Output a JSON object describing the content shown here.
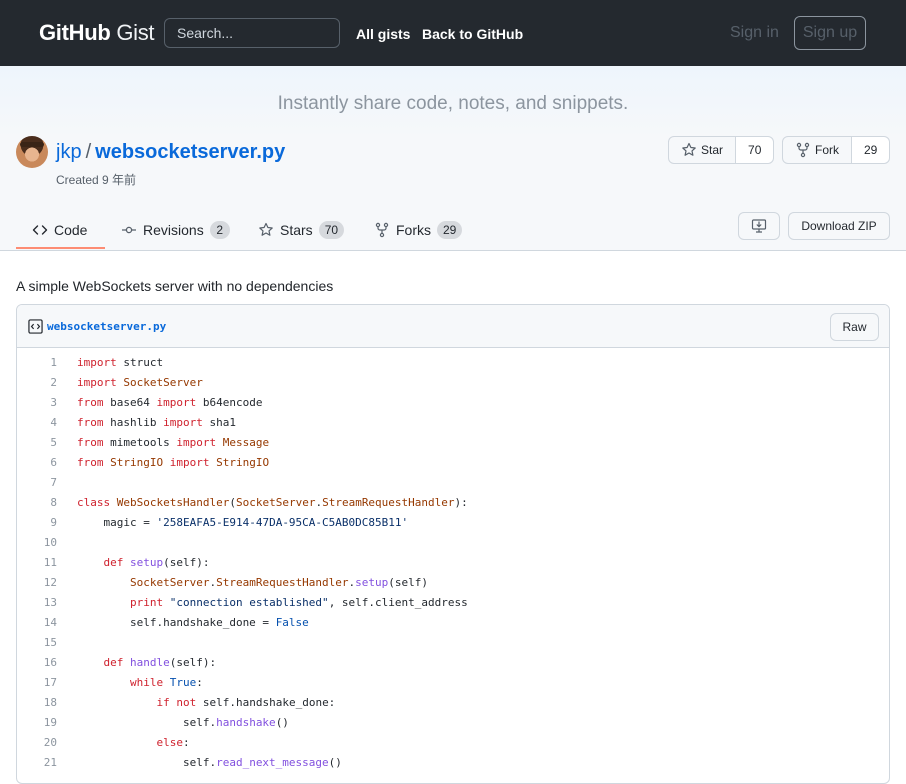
{
  "header": {
    "logo_bold": "GitHub",
    "logo_light": "Gist",
    "search_placeholder": "Search...",
    "all_gists": "All gists",
    "back_to_github": "Back to GitHub",
    "sign_in": "Sign in",
    "sign_up": "Sign up"
  },
  "banner": {
    "tagline": "Instantly share code, notes, and snippets."
  },
  "gist": {
    "owner": "jkp",
    "separator": "/",
    "filename": "websocketserver.py",
    "created": "Created 9 年前",
    "star_label": "Star",
    "star_count": "70",
    "fork_label": "Fork",
    "fork_count": "29",
    "description": "A simple WebSockets server with no dependencies"
  },
  "tabs": [
    {
      "label": "Code",
      "count": ""
    },
    {
      "label": "Revisions",
      "count": "2"
    },
    {
      "label": "Stars",
      "count": "70"
    },
    {
      "label": "Forks",
      "count": "29"
    }
  ],
  "actions": {
    "download_zip": "Download ZIP",
    "raw": "Raw"
  },
  "file": {
    "name": "websocketserver.py",
    "lines": [
      {
        "n": "1",
        "t": [
          [
            "k",
            "import"
          ],
          [
            "p",
            " struct"
          ]
        ]
      },
      {
        "n": "2",
        "t": [
          [
            "k",
            "import"
          ],
          [
            "p",
            " "
          ],
          [
            "n",
            "SocketServer"
          ]
        ]
      },
      {
        "n": "3",
        "t": [
          [
            "k",
            "from"
          ],
          [
            "p",
            " base64 "
          ],
          [
            "k",
            "import"
          ],
          [
            "p",
            " b64encode"
          ]
        ]
      },
      {
        "n": "4",
        "t": [
          [
            "k",
            "from"
          ],
          [
            "p",
            " hashlib "
          ],
          [
            "k",
            "import"
          ],
          [
            "p",
            " sha1"
          ]
        ]
      },
      {
        "n": "5",
        "t": [
          [
            "k",
            "from"
          ],
          [
            "p",
            " mimetools "
          ],
          [
            "k",
            "import"
          ],
          [
            "p",
            " "
          ],
          [
            "n",
            "Message"
          ]
        ]
      },
      {
        "n": "6",
        "t": [
          [
            "k",
            "from"
          ],
          [
            "p",
            " "
          ],
          [
            "n",
            "StringIO"
          ],
          [
            "p",
            " "
          ],
          [
            "k",
            "import"
          ],
          [
            "p",
            " "
          ],
          [
            "n",
            "StringIO"
          ]
        ]
      },
      {
        "n": "7",
        "t": []
      },
      {
        "n": "8",
        "t": [
          [
            "k",
            "class"
          ],
          [
            "p",
            " "
          ],
          [
            "n",
            "WebSocketsHandler"
          ],
          [
            "p",
            "("
          ],
          [
            "n",
            "SocketServer"
          ],
          [
            "p",
            "."
          ],
          [
            "n",
            "StreamRequestHandler"
          ],
          [
            "p",
            "):"
          ]
        ]
      },
      {
        "n": "9",
        "t": [
          [
            "p",
            "    magic = "
          ],
          [
            "s",
            "'258EAFA5-E914-47DA-95CA-C5AB0DC85B11'"
          ]
        ]
      },
      {
        "n": "10",
        "t": []
      },
      {
        "n": "11",
        "t": [
          [
            "p",
            "    "
          ],
          [
            "k",
            "def"
          ],
          [
            "p",
            " "
          ],
          [
            "f",
            "setup"
          ],
          [
            "p",
            "(self):"
          ]
        ]
      },
      {
        "n": "12",
        "t": [
          [
            "p",
            "        "
          ],
          [
            "n",
            "SocketServer"
          ],
          [
            "p",
            "."
          ],
          [
            "n",
            "StreamRequestHandler"
          ],
          [
            "p",
            "."
          ],
          [
            "f",
            "setup"
          ],
          [
            "p",
            "(self)"
          ]
        ]
      },
      {
        "n": "13",
        "t": [
          [
            "p",
            "        "
          ],
          [
            "k",
            "print"
          ],
          [
            "p",
            " "
          ],
          [
            "s",
            "\"connection established\""
          ],
          [
            "p",
            ", self.client_address"
          ]
        ]
      },
      {
        "n": "14",
        "t": [
          [
            "p",
            "        self.handshake_done = "
          ],
          [
            "c1",
            "False"
          ]
        ]
      },
      {
        "n": "15",
        "t": []
      },
      {
        "n": "16",
        "t": [
          [
            "p",
            "    "
          ],
          [
            "k",
            "def"
          ],
          [
            "p",
            " "
          ],
          [
            "f",
            "handle"
          ],
          [
            "p",
            "(self):"
          ]
        ]
      },
      {
        "n": "17",
        "t": [
          [
            "p",
            "        "
          ],
          [
            "k",
            "while"
          ],
          [
            "p",
            " "
          ],
          [
            "c1",
            "True"
          ],
          [
            "p",
            ":"
          ]
        ]
      },
      {
        "n": "18",
        "t": [
          [
            "p",
            "            "
          ],
          [
            "k",
            "if"
          ],
          [
            "p",
            " "
          ],
          [
            "k",
            "not"
          ],
          [
            "p",
            " self.handshake_done:"
          ]
        ]
      },
      {
        "n": "19",
        "t": [
          [
            "p",
            "                self."
          ],
          [
            "f",
            "handshake"
          ],
          [
            "p",
            "()"
          ]
        ]
      },
      {
        "n": "20",
        "t": [
          [
            "p",
            "            "
          ],
          [
            "k",
            "else"
          ],
          [
            "p",
            ":"
          ]
        ]
      },
      {
        "n": "21",
        "t": [
          [
            "p",
            "                self."
          ],
          [
            "f",
            "read_next_message"
          ],
          [
            "p",
            "()"
          ]
        ]
      }
    ]
  }
}
